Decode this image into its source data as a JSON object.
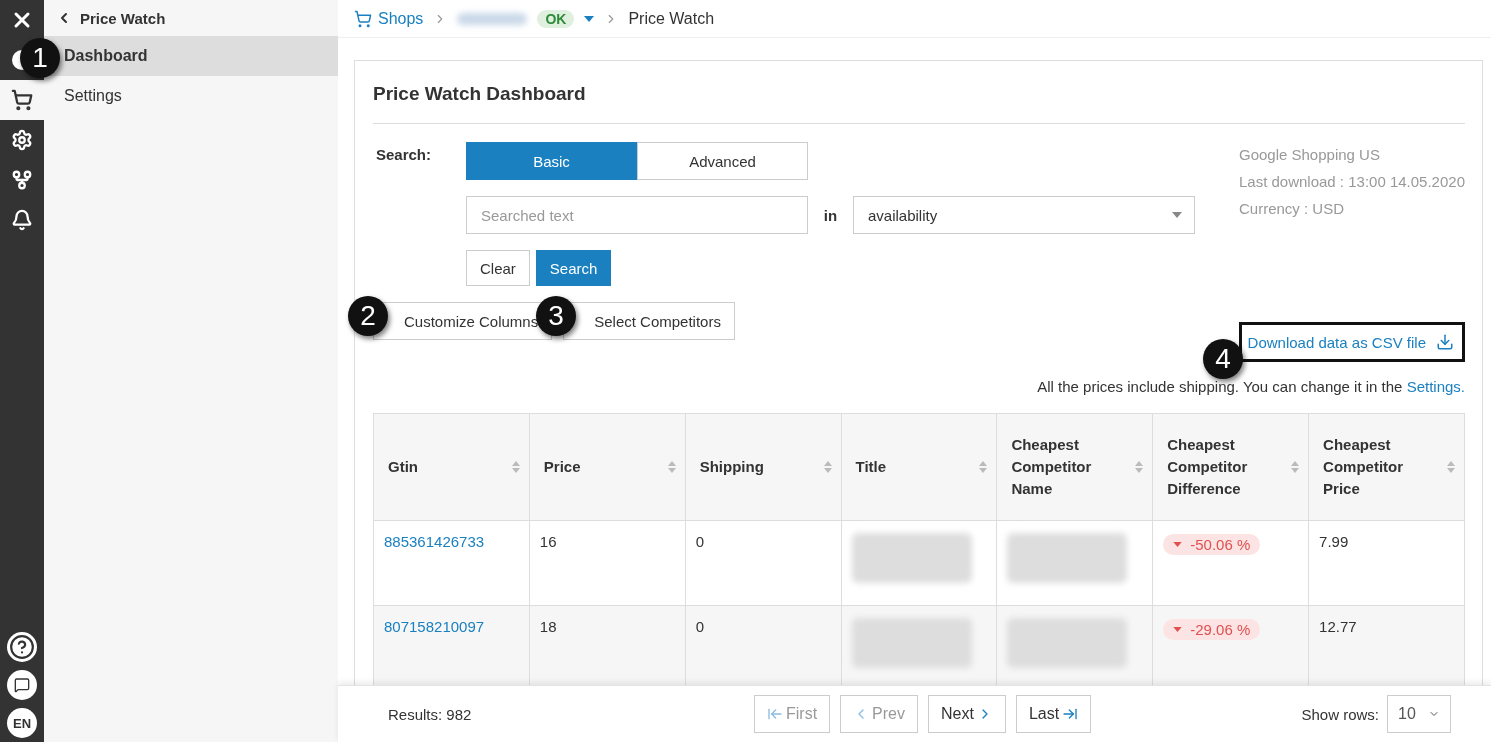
{
  "nav_rail": {
    "items": [
      {
        "kind": "toggle",
        "selected": false
      },
      {
        "kind": "cart",
        "selected": true
      },
      {
        "kind": "gear",
        "selected": false
      },
      {
        "kind": "branch",
        "selected": false
      },
      {
        "kind": "bell",
        "selected": false
      }
    ],
    "language": "EN"
  },
  "sidebar": {
    "back": "Price Watch",
    "items": [
      {
        "label": "Dashboard",
        "selected": true
      },
      {
        "label": "Settings",
        "selected": false
      }
    ]
  },
  "breadcrumb": {
    "root": "Shops",
    "status": "OK",
    "current": "Price Watch"
  },
  "card": {
    "title": "Price Watch Dashboard",
    "search_label": "Search:",
    "modes": [
      {
        "label": "Basic",
        "selected": true
      },
      {
        "label": "Advanced",
        "selected": false
      }
    ],
    "search": {
      "placeholder": "Searched text"
    },
    "in_label": "in",
    "field_select": "availability",
    "search_buttons": [
      {
        "label": "Clear",
        "primary": false
      },
      {
        "label": "Search",
        "primary": true
      }
    ],
    "tools": [
      "Customize Columns",
      "Select Competitors"
    ],
    "info": [
      "Google Shopping US",
      "Last download : 13:00 14.05.2020",
      "Currency : USD"
    ],
    "download": "Download data as CSV file",
    "note": "All the prices include shipping. You can change it in the ",
    "note_link": "Settings."
  },
  "table": {
    "columns": [
      {
        "label": "Gtin",
        "kind": "link"
      },
      {
        "label": "Price",
        "kind": "text"
      },
      {
        "label": "Shipping",
        "kind": "text"
      },
      {
        "label": "Title",
        "kind": "blurred"
      },
      {
        "label": "Cheapest Competitor Name",
        "kind": "blurred"
      },
      {
        "label": "Cheapest Competitor Difference",
        "kind": "change"
      },
      {
        "label": "Cheapest Competitor Price",
        "kind": "text"
      }
    ],
    "rows": [
      {
        "cells": [
          "885361426733",
          "16",
          "0",
          "",
          "",
          "-50.06 %",
          "7.99"
        ]
      },
      {
        "cells": [
          "807158210097",
          "18",
          "0",
          "",
          "",
          "-29.06 %",
          "12.77"
        ]
      }
    ]
  },
  "footer": {
    "results": "Results: 982",
    "pager": [
      {
        "label": "First",
        "kind": "first",
        "disabled": true
      },
      {
        "label": "Prev",
        "kind": "prev",
        "disabled": true
      },
      {
        "label": "Next",
        "kind": "next",
        "disabled": false
      },
      {
        "label": "Last",
        "kind": "last",
        "disabled": false
      }
    ],
    "rows_label": "Show rows:",
    "rows_value": "10"
  },
  "callouts": [
    "1",
    "2",
    "3",
    "4"
  ]
}
